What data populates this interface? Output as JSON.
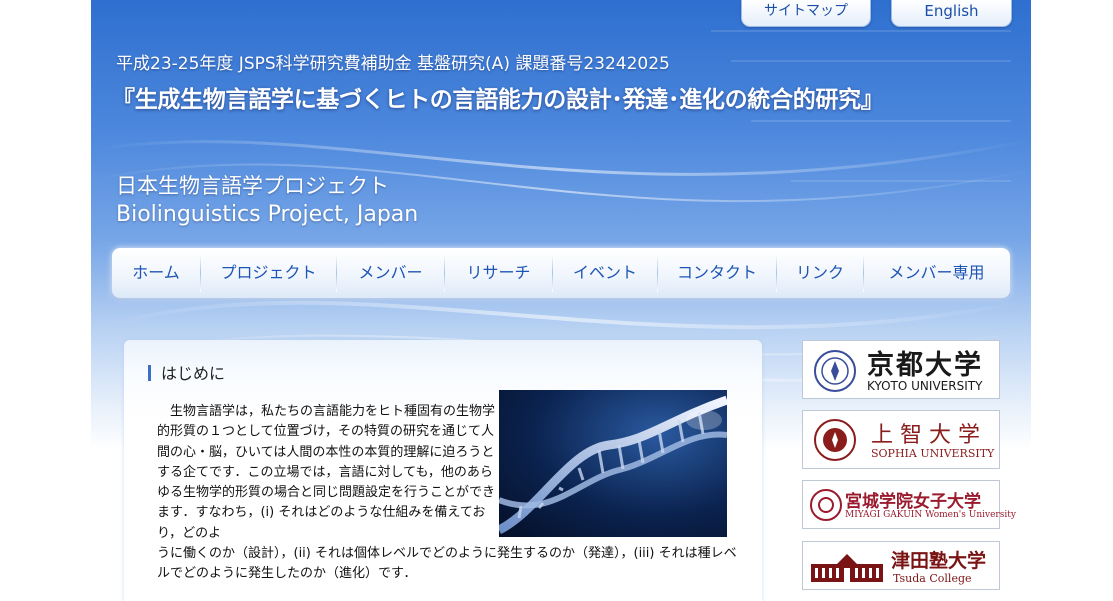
{
  "header": {
    "links": {
      "sitemap": "サイトマップ",
      "english": "English"
    },
    "grant_line": "平成23-25年度 JSPS科学研究費補助金 基盤研究(A) 課題番号23242025",
    "research_title": "『生成生物言語学に基づくヒトの言語能力の設計･発達･進化の統合的研究』",
    "project_name_jp": "日本生物言語学プロジェクト",
    "project_name_en": "Biolinguistics Project, Japan"
  },
  "nav": {
    "items": [
      {
        "label": "ホーム"
      },
      {
        "label": "プロジェクト"
      },
      {
        "label": "メンバー"
      },
      {
        "label": "リサーチ"
      },
      {
        "label": "イベント"
      },
      {
        "label": "コンタクト"
      },
      {
        "label": "リンク"
      },
      {
        "label": "メンバー専用"
      }
    ]
  },
  "main": {
    "section_title": "はじめに",
    "intro_p1": "　生物言語学は，私たちの言語能力をヒト種固有の生物学的形質の１つとして位置づけ，その特質の研究を通じて人間の心・脳，ひいては人間の本性の本質的理解に迫ろうとする企てです．この立場では，言語に対しても，他のあらゆる生物学的形質の場合と同じ問題設定を行うことができます．すなわち，(i) それはどのような仕組みを備えており，どのよ",
    "intro_p2": "うに働くのか（設計），(ii) それは個体レベルでどのように発生するのか（発達），(iii) それは種レベルでどのように発生したのか（進化）です．"
  },
  "sidebar": {
    "universities": [
      {
        "name_jp": "京都大学",
        "name_en": "KYOTO UNIVERSITY",
        "color": "#1a1a1a"
      },
      {
        "name_jp": "上 智 大 学",
        "name_en": "SOPHIA UNIVERSITY",
        "color": "#8a1c1c"
      },
      {
        "name_jp": "宮城学院女子大学",
        "name_en": "MIYAGI GAKUIN Women's University",
        "color": "#9b1b2e"
      },
      {
        "name_jp": "津田塾大学",
        "name_en": "Tsuda College",
        "color": "#7a1414"
      }
    ]
  },
  "colors": {
    "header_blue": "#2e6fcf",
    "nav_text": "#1d55b4",
    "accent_bar": "#3a6fc4"
  }
}
